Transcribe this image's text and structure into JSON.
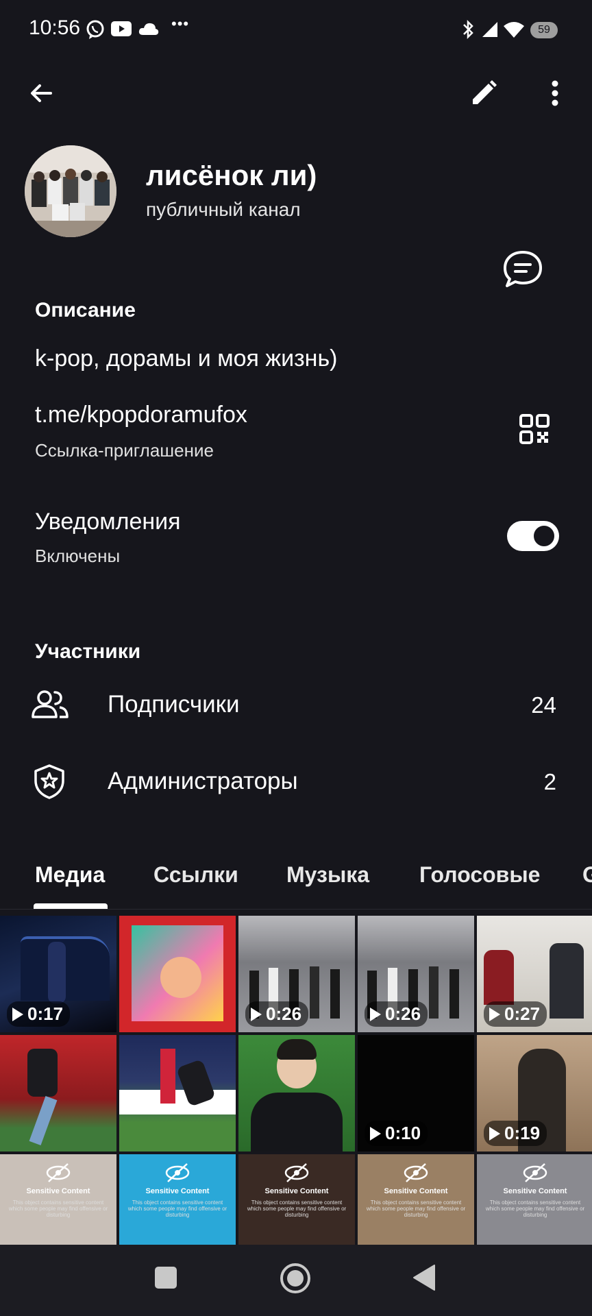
{
  "status_bar": {
    "time": "10:56",
    "battery": "59",
    "overflow_dots": "•••"
  },
  "channel": {
    "name": "лисёнок ли)",
    "type": "публичный канал"
  },
  "description": {
    "title": "Описание",
    "text": "k-pop, дорамы и моя жизнь)"
  },
  "link": {
    "url": "t.me/kpopdoramufox",
    "label": "Ссылка-приглашение"
  },
  "notifications": {
    "title": "Уведомления",
    "state": "Включены",
    "enabled": true
  },
  "members": {
    "title": "Участники",
    "subscribers_label": "Подписчики",
    "subscribers_count": "24",
    "admins_label": "Администраторы",
    "admins_count": "2"
  },
  "tabs": [
    "Медиа",
    "Ссылки",
    "Музыка",
    "Голосовые",
    "G"
  ],
  "media": {
    "durations": [
      "0:17",
      "0:26",
      "0:26",
      "0:27",
      "0:10",
      "0:19"
    ],
    "sensitive_title": "Sensitive Content",
    "sensitive_text": "This object contains sensitive content which some people may find offensive or disturbing"
  },
  "colors": {
    "background": "#16161c",
    "text": "#ffffff",
    "accent_toggle": "#ffffff"
  }
}
